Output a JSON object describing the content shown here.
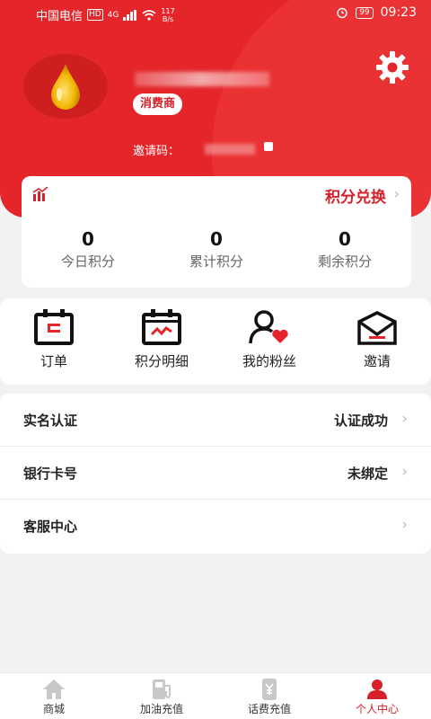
{
  "status_bar": {
    "carrier": "中国电信",
    "hd": "HD",
    "network": "4G",
    "speed_value": "117",
    "speed_unit": "B/s",
    "battery": "99",
    "time": "09:23"
  },
  "profile": {
    "badge": "消费商",
    "invite_label": "邀请码："
  },
  "points": {
    "exchange_label": "积分兑换",
    "chevron": "›",
    "stats": [
      {
        "value": "0",
        "label": "今日积分"
      },
      {
        "value": "0",
        "label": "累计积分"
      },
      {
        "value": "0",
        "label": "剩余积分"
      }
    ]
  },
  "menu": [
    {
      "label": "订单",
      "icon": "order-icon"
    },
    {
      "label": "积分明细",
      "icon": "points-detail-icon"
    },
    {
      "label": "我的粉丝",
      "icon": "fans-icon"
    },
    {
      "label": "邀请",
      "icon": "invite-icon"
    }
  ],
  "settings_list": [
    {
      "key": "实名认证",
      "value": "认证成功"
    },
    {
      "key": "银行卡号",
      "value": "未绑定"
    },
    {
      "key": "客服中心",
      "value": ""
    }
  ],
  "bottom_nav": [
    {
      "label": "商城",
      "icon": "home-icon"
    },
    {
      "label": "加油充值",
      "icon": "fuel-icon"
    },
    {
      "label": "话费充值",
      "icon": "phone-bill-icon"
    },
    {
      "label": "个人中心",
      "icon": "person-icon"
    }
  ],
  "colors": {
    "primary": "#e4262a",
    "accent_text": "#d6202a",
    "gold": "#f2b705"
  }
}
